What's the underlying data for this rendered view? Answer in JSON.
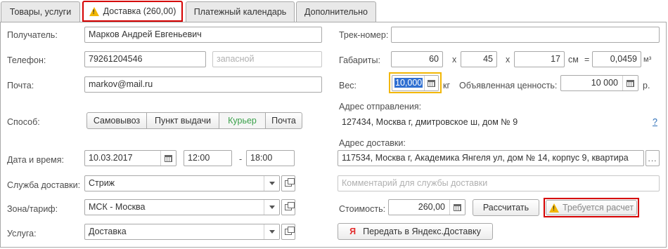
{
  "tabs": [
    {
      "label": "Товары, услуги"
    },
    {
      "label": "Доставка (260,00)"
    },
    {
      "label": "Платежный календарь"
    },
    {
      "label": "Дополнительно"
    }
  ],
  "left": {
    "recipient_label": "Получатель:",
    "recipient_value": "Марков Андрей Евгеньевич",
    "phone_label": "Телефон:",
    "phone_value": "79261204546",
    "phone_backup_placeholder": "запасной",
    "email_label": "Почта:",
    "email_value": "markov@mail.ru",
    "method_label": "Способ:",
    "methods": [
      "Самовывоз",
      "Пункт выдачи",
      "Курьер",
      "Почта"
    ],
    "selected_method": "Курьер",
    "datetime_label": "Дата и время:",
    "date_value": "10.03.2017",
    "time_from": "12:00",
    "time_dash": "-",
    "time_to": "18:00",
    "service_label": "Служба доставки:",
    "service_value": "Стриж",
    "zone_label": "Зона/тариф:",
    "zone_value": "МСК - Москва",
    "usluga_label": "Услуга:",
    "usluga_value": "Доставка"
  },
  "right": {
    "track_label": "Трек-номер:",
    "track_value": "",
    "dims_label": "Габариты:",
    "dim_length": "60",
    "dim_width": "45",
    "dim_height": "17",
    "x_symbol": "x",
    "cm_unit": "см",
    "equals": "=",
    "volume_value": "0,0459",
    "volume_unit": "м³",
    "weight_label": "Вес:",
    "weight_value": "10,000",
    "weight_unit": "кг",
    "declared_label": "Объявленная ценность:",
    "declared_value": "10 000",
    "currency_unit": "р.",
    "from_label": "Адрес отправления:",
    "from_value": "127434, Москва г, дмитровское ш, дом № 9",
    "help": "?",
    "to_label": "Адрес доставки:",
    "to_value": "117534, Москва г, Академика Янгеля ул, дом № 14, корпус 9, квартира",
    "comment_placeholder": "Комментарий для службы доставки",
    "cost_label": "Стоимость:",
    "cost_value": "260,00",
    "calc_button": "Рассчитать",
    "needs_calc": "Требуется расчет",
    "yandex_logo": "Я",
    "yandex_button": "Передать в Яндекс.Доставку"
  },
  "colors": {
    "highlight_red": "#d50000",
    "focus_yellow": "#f2b705",
    "selected_green": "#3aa14a",
    "warning_yellow": "#f2b705"
  }
}
